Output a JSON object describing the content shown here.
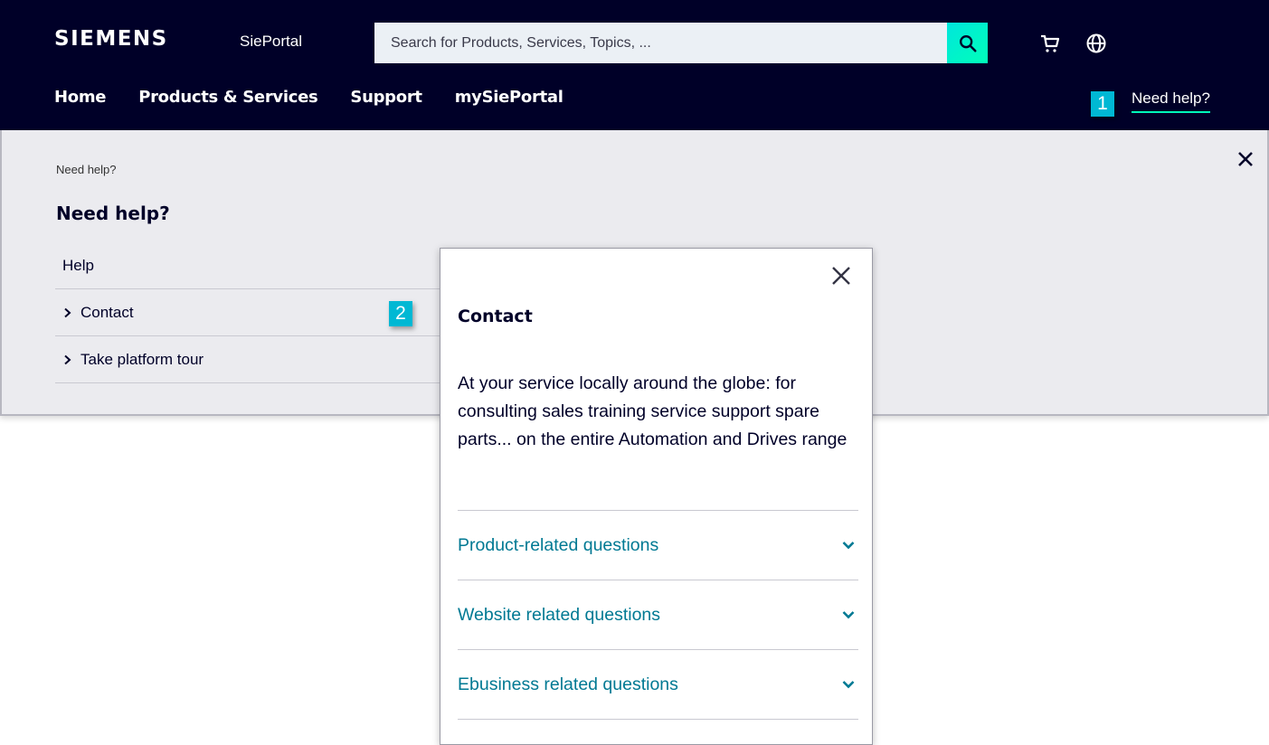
{
  "header": {
    "logo": "SIEMENS",
    "portal_name": "SiePortal",
    "search_placeholder": "Search for Products, Services, Topics, ...",
    "nav": [
      "Home",
      "Products & Services",
      "Support",
      "mySiePortal"
    ],
    "need_help_link": "Need help?",
    "icons": [
      "cart-icon",
      "globe-icon",
      "search-icon"
    ]
  },
  "callouts": {
    "first": "1",
    "second": "2"
  },
  "help_panel": {
    "breadcrumb": "Need help?",
    "title": "Need help?",
    "items": [
      {
        "label": "Help",
        "expandable": false
      },
      {
        "label": "Contact",
        "expandable": true
      },
      {
        "label": "Take platform tour",
        "expandable": true
      }
    ]
  },
  "contact_popup": {
    "title": "Contact",
    "description": "At your service locally around the globe: for consulting sales training service support spare parts... on the entire Automation and Drives range",
    "accordion": [
      {
        "label": "Product-related questions"
      },
      {
        "label": "Website related questions"
      },
      {
        "label": "Ebusiness related questions"
      }
    ]
  },
  "colors": {
    "header_bg": "#000028",
    "accent": "#00ffb9",
    "link": "#007993",
    "panel_bg": "#ebebef",
    "callout": "#00b8d4"
  }
}
